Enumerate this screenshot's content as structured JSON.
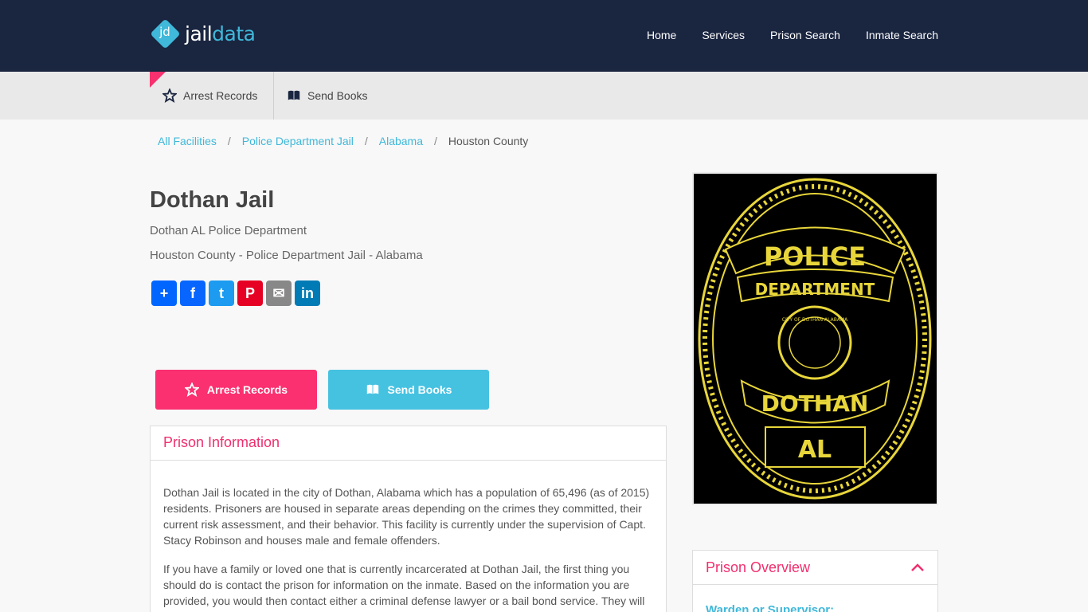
{
  "header": {
    "logo_mark": "jd",
    "logo_left": "jail",
    "logo_right": "data",
    "nav": [
      "Home",
      "Services",
      "Prison Search",
      "Inmate Search"
    ]
  },
  "subnav": {
    "arrest": "Arrest Records",
    "books": "Send Books"
  },
  "breadcrumb": {
    "items": [
      "All Facilities",
      "Police Department Jail",
      "Alabama"
    ],
    "current": "Houston County"
  },
  "page": {
    "title": "Dothan Jail",
    "subtitle1": "Dothan AL Police Department",
    "subtitle2": "Houston County - Police Department Jail - Alabama"
  },
  "share": {
    "buttons": [
      {
        "name": "share-add",
        "glyph": "+",
        "color": "#0166ff"
      },
      {
        "name": "share-facebook",
        "glyph": "f",
        "color": "#0866ff"
      },
      {
        "name": "share-twitter",
        "glyph": "t",
        "color": "#1d9bf0"
      },
      {
        "name": "share-pinterest",
        "glyph": "P",
        "color": "#e60023"
      },
      {
        "name": "share-email",
        "glyph": "✉",
        "color": "#888888"
      },
      {
        "name": "share-linkedin",
        "glyph": "in",
        "color": "#007bb5"
      }
    ]
  },
  "cta": {
    "arrest": "Arrest Records",
    "books": "Send Books"
  },
  "info": {
    "heading": "Prison Information",
    "p1": "Dothan Jail is located in the city of Dothan, Alabama which has a population of 65,496 (as of 2015) residents. Prisoners are housed in separate areas depending on the crimes they committed, their current risk assessment, and their behavior. This facility is currently under the supervision of Capt. Stacy Robinson and houses male and female offenders.",
    "p2": "If you have a family or loved one that is currently incarcerated at Dothan Jail, the first thing you should do is contact the prison for information on the inmate. Based on the information you are provided, you would then contact either a criminal defense lawyer or a bail bond service. They will provide you with vital information which can be used to defend an individual and to"
  },
  "badge": {
    "top": "POLICE",
    "middle": "DEPARTMENT",
    "city": "DOTHAN",
    "state": "AL",
    "seal": "CITY OF DOTHAN ALABAMA"
  },
  "overview": {
    "heading": "Prison Overview",
    "first_label": "Warden or Supervisor:"
  },
  "colors": {
    "navy": "#1a2540",
    "accent_pink": "#fb3070",
    "accent_blue": "#46c2e1"
  }
}
